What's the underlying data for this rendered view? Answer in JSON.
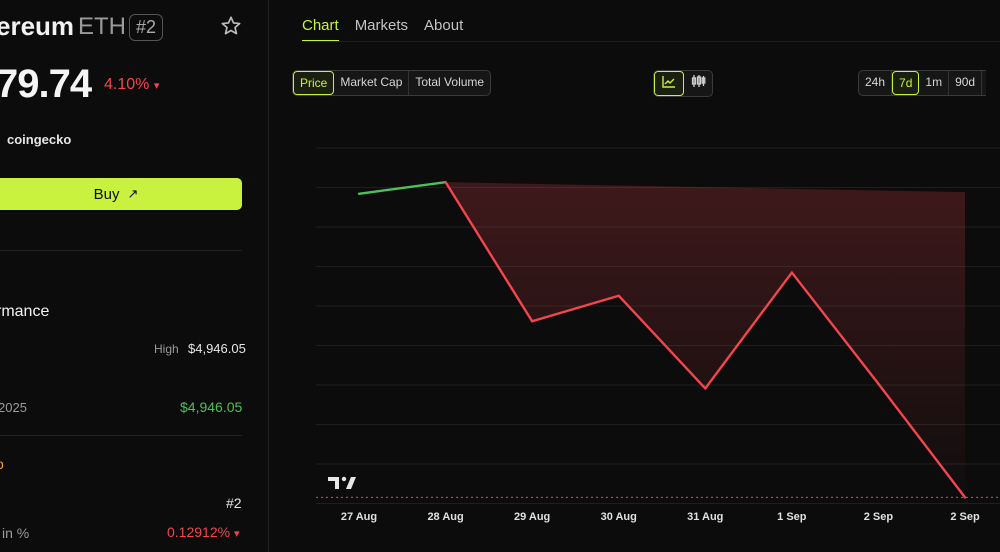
{
  "coin": {
    "name_visible": "ereum",
    "ticker": "ETH",
    "rank_badge": "#2",
    "price_visible": "79.74",
    "change_pct": "4.10%",
    "change_arrow": "▾",
    "source_label": "coingecko"
  },
  "buy": {
    "label": "Buy",
    "icon": "↗"
  },
  "performance": {
    "title_visible": "rmance",
    "high_label": "High",
    "high_value": "$4,946.05",
    "ath_year_visible": "2025",
    "ath_value": "$4,946.05",
    "cut_glyph": "o",
    "rank_value": "#2",
    "pct_label_visible": "in %",
    "pct_value": "0.12912%",
    "pct_arrow": "▾"
  },
  "tabs": [
    "Chart",
    "Markets",
    "About"
  ],
  "metric_buttons": [
    "Price",
    "Market Cap",
    "Total Volume"
  ],
  "chart_type_icons": [
    "line-chart-icon",
    "candlestick-icon"
  ],
  "range_buttons": [
    "24h",
    "7d",
    "1m",
    "90d"
  ],
  "colors": {
    "accent": "#c8f23e",
    "down": "#f2464e",
    "up": "#4fbf5a"
  },
  "chart_data": {
    "type": "line",
    "x": [
      "27 Aug",
      "28 Aug",
      "29 Aug",
      "30 Aug",
      "31 Aug",
      "1 Sep",
      "2 Sep",
      "2 Sep"
    ],
    "series": [
      {
        "values": [
          4615,
          4640,
          4340,
          4395,
          4195,
          4445,
          4205,
          3960
        ]
      }
    ],
    "ylim": [
      3950,
      4800
    ],
    "grid": true,
    "legend": "none",
    "watermark": "TradingView logo"
  }
}
